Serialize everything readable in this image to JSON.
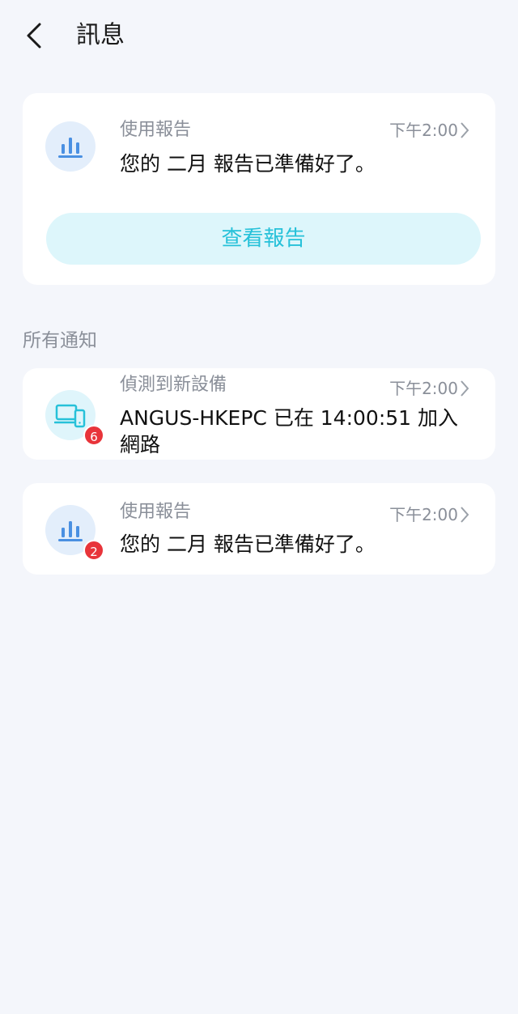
{
  "header": {
    "title": "訊息"
  },
  "report_card": {
    "label": "使用報告",
    "time": "下午2:00",
    "message": "您的 二月 報告已準備好了。",
    "button_label": "查看報告"
  },
  "section": {
    "title": "所有通知"
  },
  "notifications": [
    {
      "label": "偵測到新設備",
      "time": "下午2:00",
      "message": "ANGUS-HKEPC 已在 14:00:51 加入網路",
      "badge": "6",
      "icon": "devices-icon"
    },
    {
      "label": "使用報告",
      "time": "下午2:00",
      "message": "您的 二月 報告已準備好了。",
      "badge": "2",
      "icon": "bar-chart-icon"
    }
  ],
  "colors": {
    "background": "#f4f6fb",
    "accent": "#26c1d9",
    "badge": "#e8343a",
    "chart_icon": "#4a90e2"
  }
}
